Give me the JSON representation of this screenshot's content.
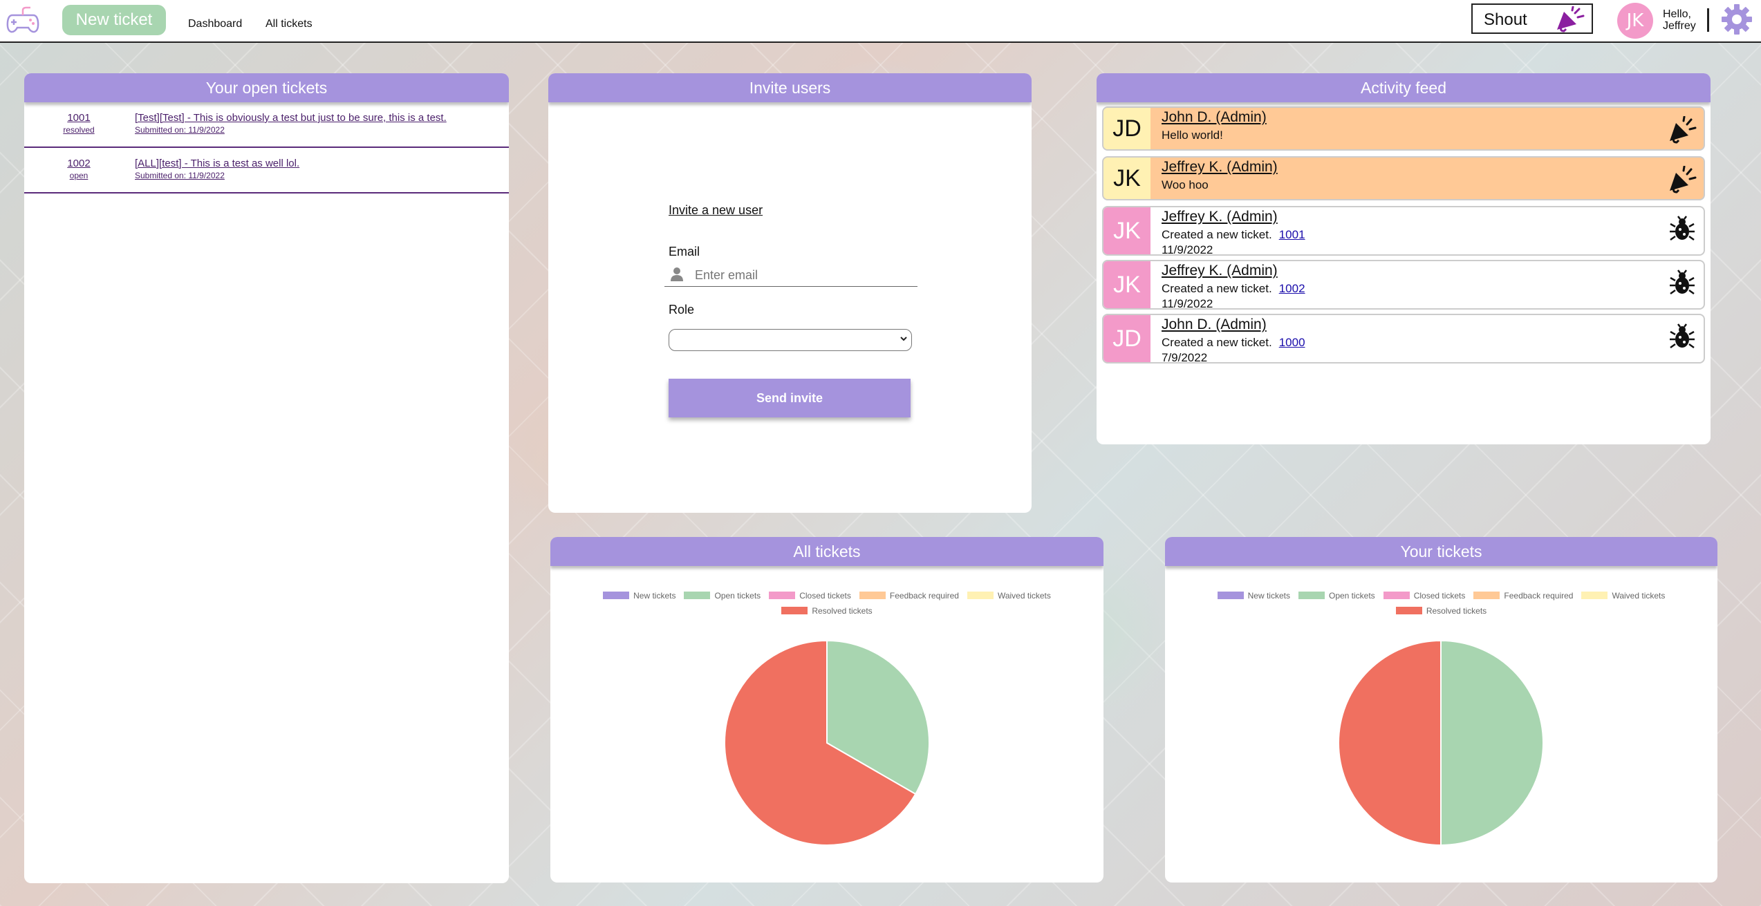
{
  "nav": {
    "new_ticket": "New ticket",
    "dashboard": "Dashboard",
    "all_tickets": "All tickets",
    "shout": "Shout",
    "avatar_initials": "JK",
    "hello_line1": "Hello,",
    "hello_line2": "Jeffrey"
  },
  "open_tickets": {
    "title": "Your open tickets",
    "items": [
      {
        "id": "1001",
        "status": "resolved",
        "title": "[Test][Test] - This is obviously a test but just to be sure, this is a test.",
        "submitted": "Submitted on: 11/9/2022"
      },
      {
        "id": "1002",
        "status": "open",
        "title": "[ALL][test] - This is a test as well lol.",
        "submitted": "Submitted on: 11/9/2022"
      }
    ]
  },
  "invite": {
    "title": "Invite users",
    "link": "Invite a new user",
    "email_label": "Email",
    "email_placeholder": "Enter email",
    "role_label": "Role",
    "role_value": "",
    "send": "Send invite"
  },
  "feed": {
    "title": "Activity feed",
    "items": [
      {
        "initials": "JD",
        "name": "John D. (Admin)",
        "text": "Hello world!",
        "link": "",
        "date": "",
        "icon": "megaphone-icon",
        "bg": "#ffc996",
        "avatar_bg": "#fff1b3",
        "avatar_fg": "#111"
      },
      {
        "initials": "JK",
        "name": "Jeffrey K. (Admin)",
        "text": "Woo hoo",
        "link": "",
        "date": "",
        "icon": "megaphone-icon",
        "bg": "#ffc996",
        "avatar_bg": "#fff1b3",
        "avatar_fg": "#111"
      },
      {
        "initials": "JK",
        "name": "Jeffrey K. (Admin)",
        "text": "Created a new ticket.",
        "link": "1001",
        "date": "11/9/2022",
        "icon": "bug-icon",
        "bg": "#ffffff",
        "avatar_bg": "#f39ac9",
        "avatar_fg": "#ffffff"
      },
      {
        "initials": "JK",
        "name": "Jeffrey K. (Admin)",
        "text": "Created a new ticket.",
        "link": "1002",
        "date": "11/9/2022",
        "icon": "bug-icon",
        "bg": "#ffffff",
        "avatar_bg": "#f39ac9",
        "avatar_fg": "#ffffff"
      },
      {
        "initials": "JD",
        "name": "John D. (Admin)",
        "text": "Created a new ticket.",
        "link": "1000",
        "date": "7/9/2022",
        "icon": "bug-icon",
        "bg": "#ffffff",
        "avatar_bg": "#f39ac9",
        "avatar_fg": "#ffffff"
      }
    ]
  },
  "colors": {
    "accent": "#a593dd",
    "new_ticket_green": "#a8d5b0",
    "avatar_pink": "#f39ac9",
    "shout_orange": "#ffc996"
  },
  "chart_data": [
    {
      "type": "pie",
      "title": "All tickets",
      "categories": [
        "New tickets",
        "Open tickets",
        "Closed tickets",
        "Feedback required",
        "Waived tickets",
        "Resolved tickets"
      ],
      "colors": [
        "#a593dd",
        "#a8d5b0",
        "#f39ac9",
        "#ffc996",
        "#fff1b3",
        "#f07060"
      ],
      "values": [
        0,
        1,
        0,
        0,
        0,
        2
      ],
      "legend": "top"
    },
    {
      "type": "pie",
      "title": "Your tickets",
      "categories": [
        "New tickets",
        "Open tickets",
        "Closed tickets",
        "Feedback required",
        "Waived tickets",
        "Resolved tickets"
      ],
      "colors": [
        "#a593dd",
        "#a8d5b0",
        "#f39ac9",
        "#ffc996",
        "#fff1b3",
        "#f07060"
      ],
      "values": [
        0,
        1,
        0,
        0,
        0,
        1
      ],
      "legend": "top"
    }
  ]
}
